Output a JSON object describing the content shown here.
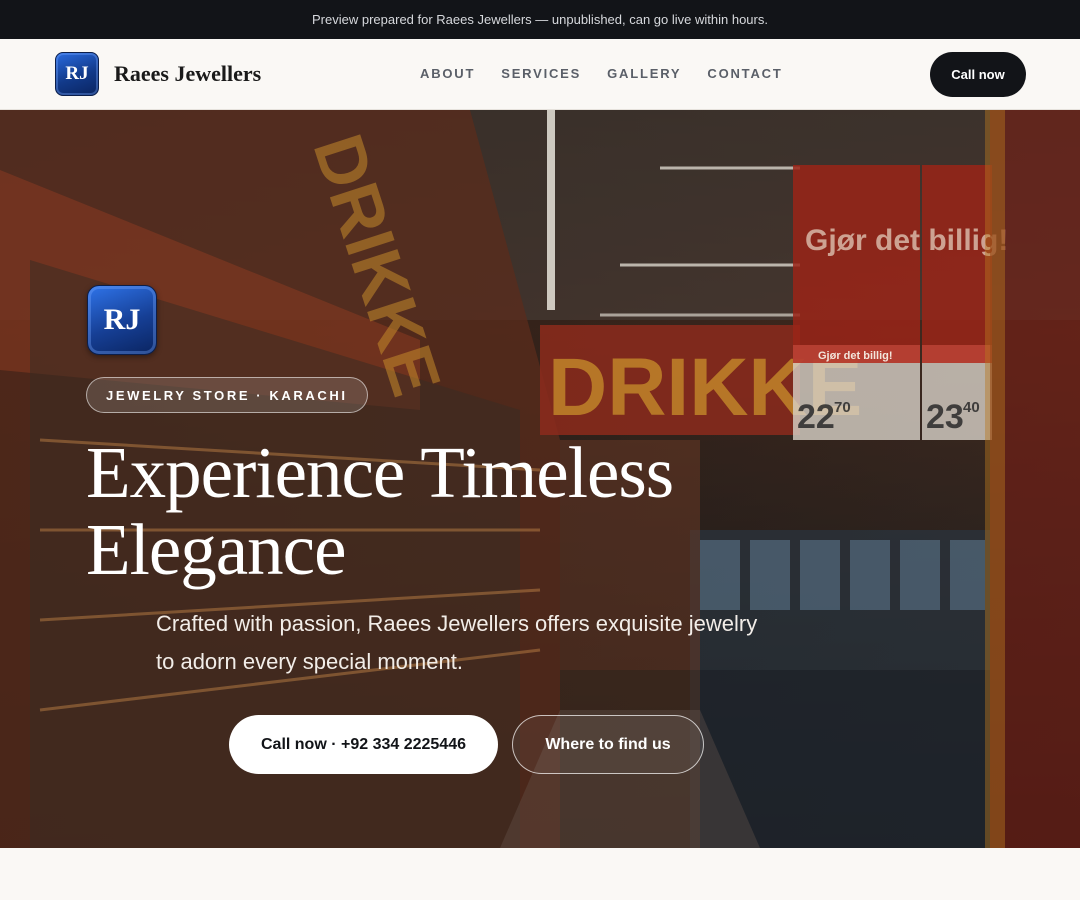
{
  "preview_bar": {
    "text": "Preview prepared for Raees Jewellers — unpublished, can go live within hours."
  },
  "header": {
    "logo_text": "RJ",
    "brand_name": "Raees Jewellers",
    "nav": [
      {
        "label": "ABOUT"
      },
      {
        "label": "SERVICES"
      },
      {
        "label": "GALLERY"
      },
      {
        "label": "CONTACT"
      }
    ],
    "cta_label": "Call now"
  },
  "hero": {
    "logo_text": "RJ",
    "badge": "JEWELRY STORE · KARACHI",
    "headline_line1": "Experience Timeless",
    "headline_line2": "Elegance",
    "subtitle": "Crafted with passion, Raees Jewellers offers exquisite jewelry to adorn every special moment.",
    "primary_button": "Call now · +92 334 2225446",
    "secondary_button": "Where to find us",
    "photo_signs": {
      "drikke": "DRIKKE",
      "sign_big": "Gjør det billig!",
      "sign_small": "Gjør det billig!",
      "price1_main": "22",
      "price1_cents": "70",
      "price2_main": "23",
      "price2_cents": "40"
    }
  },
  "colors": {
    "dark": "#121418",
    "logo_blue": "#163f95",
    "page_bg": "#faf8f5"
  }
}
